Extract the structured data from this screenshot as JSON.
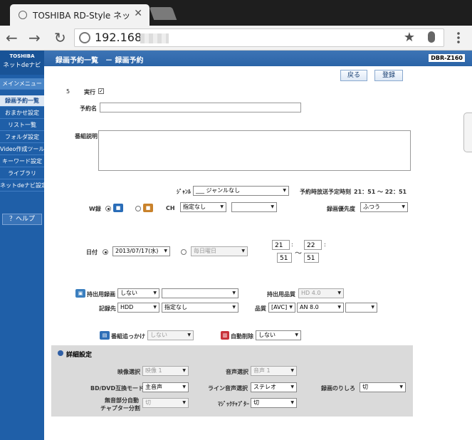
{
  "browser": {
    "tab_title": "TOSHIBA RD-Style ネッ",
    "url": "192.168."
  },
  "sidebar": {
    "brand": "TOSHIBA",
    "app": "ネットdeナビ",
    "items": [
      "メインメニュー",
      "録画予約一覧",
      "おまかせ設定",
      "リスト一覧",
      "フォルダ設定",
      "Video作成ツール",
      "キーワード設定",
      "ライブラリ",
      "ネットdeナビ設定"
    ],
    "help": "？ヘルプ"
  },
  "header": {
    "title": "録画予約一覧　－ 録画予約",
    "model": "DBR-Z160"
  },
  "actions": {
    "back": "戻る",
    "register": "登録"
  },
  "form": {
    "number": "5",
    "exec_label": "実行",
    "exec_check": "✓",
    "name_label": "予約名",
    "desc_label": "番組説明",
    "genre_label": "ｼﾞｬﾝﾙ",
    "genre_value": "___ ジャンルなし",
    "schedule_label": "予約時放送予定時刻",
    "schedule_value": "21：51 ～ 22：51",
    "wrec_label": "W録",
    "ch_label": "CH",
    "ch_value": "指定なし",
    "priority_label": "録画優先度",
    "priority_value": "ふつう",
    "date_label": "日付",
    "date_value": "2013/07/17(水)",
    "weekday_value": "毎日曜日",
    "start_h": "21",
    "start_m": "51",
    "end_h": "22",
    "end_m": "51",
    "colon": ":",
    "tilde": "～",
    "carry_label": "持出用録画",
    "carry_value": "しない",
    "carry_quality_label": "持出用品質",
    "carry_quality_value": "HD 4.0",
    "dest_label": "記録先",
    "dest_value": "HDD",
    "dest_sub": "指定なし",
    "quality_label": "品質",
    "quality_mode": "[AVC]",
    "quality_value": "AN 8.0",
    "follow_label": "番組追っかけ",
    "follow_value": "しない",
    "autodelete_label": "自動削除",
    "autodelete_value": "しない"
  },
  "detail": {
    "title": "詳細設定",
    "video_label": "映像選択",
    "video_value": "映像 1",
    "audio_label": "音声選択",
    "audio_value": "音声 1",
    "bd_label": "BD/DVD互換モード",
    "bd_value": "主音声",
    "line_label": "ライン音声選択",
    "line_value": "ステレオ",
    "margin_label": "録画のりしろ",
    "margin_value": "切",
    "chapter_label1": "無音部分自動",
    "chapter_label2": "チャプター分割",
    "chapter_value": "切",
    "magic_label": "ﾏｼﾞｯｸﾁｬﾌﾟﾀｰ",
    "magic_value": "切"
  }
}
